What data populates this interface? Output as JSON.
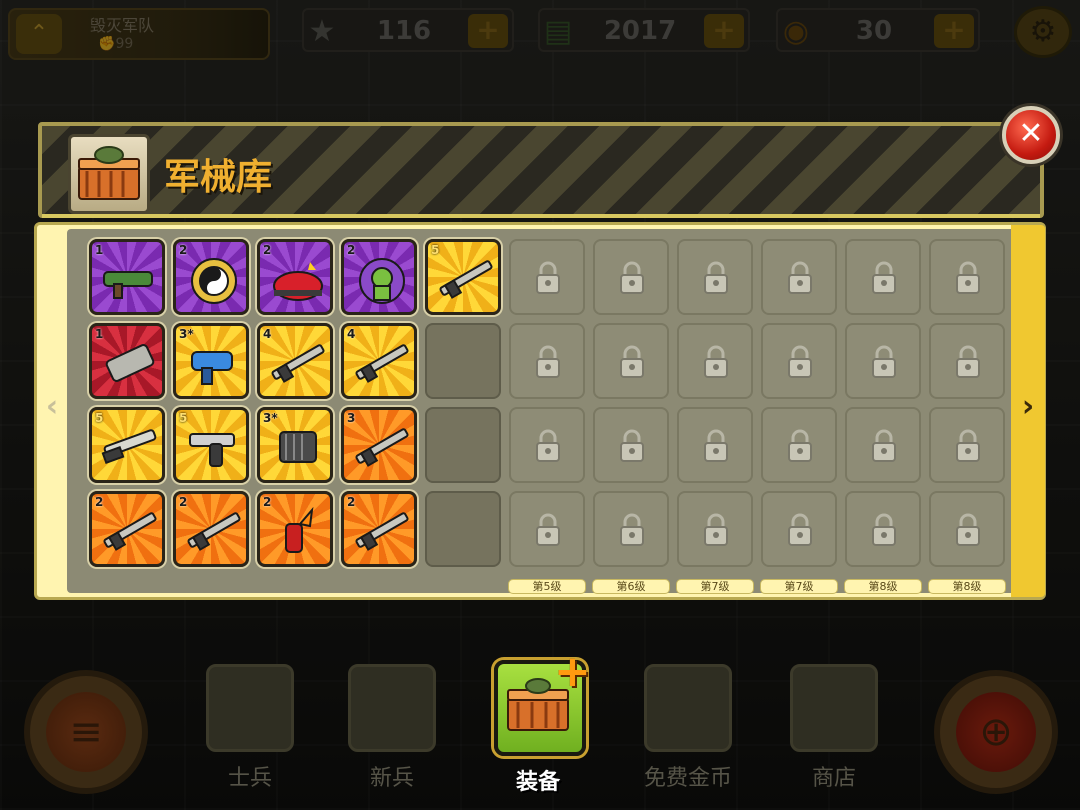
{
  "hud": {
    "team_name": "毁灭军队",
    "power": "99",
    "stars": "116",
    "cash": "2017",
    "coins": "30",
    "plus": "+"
  },
  "panel": {
    "title": "军械库",
    "close": "✕"
  },
  "nav": {
    "prev_arrow": "‹",
    "next_arrow": "›"
  },
  "items": [
    {
      "level": "1",
      "rarity": "purple",
      "icon": "rocket-launcher-icon"
    },
    {
      "level": "2",
      "rarity": "purple",
      "icon": "yin-yang-medal-icon"
    },
    {
      "level": "2",
      "rarity": "purple",
      "icon": "alarm-helmet-icon"
    },
    {
      "level": "2",
      "rarity": "purple",
      "icon": "soldier-shield-icon"
    },
    {
      "level": "5",
      "rarity": "yellow",
      "icon": "assault-rifle-icon"
    },
    {
      "level": "1",
      "rarity": "red",
      "icon": "cannon-barrel-icon"
    },
    {
      "level": "3*",
      "rarity": "yellow",
      "icon": "taser-gun-icon"
    },
    {
      "level": "4",
      "rarity": "yellow",
      "icon": "heavy-rifle-icon"
    },
    {
      "level": "4",
      "rarity": "yellow",
      "icon": "sniper-rifle-icon"
    },
    {
      "level": "5",
      "rarity": "yellow",
      "icon": "shotgun-icon"
    },
    {
      "level": "5",
      "rarity": "yellow",
      "icon": "pistol-icon"
    },
    {
      "level": "3*",
      "rarity": "yellow",
      "icon": "minigun-icon"
    },
    {
      "level": "3",
      "rarity": "orange",
      "icon": "battle-rifle-icon"
    },
    {
      "level": "2",
      "rarity": "orange",
      "icon": "plasma-rifle-icon"
    },
    {
      "level": "2",
      "rarity": "orange",
      "icon": "smg-icon"
    },
    {
      "level": "2",
      "rarity": "orange",
      "icon": "molotov-icon"
    },
    {
      "level": "2",
      "rarity": "orange",
      "icon": "marksman-rifle-icon"
    }
  ],
  "unlock_labels": [
    "第5级",
    "第6级",
    "第7级",
    "第7级",
    "第8级",
    "第8级"
  ],
  "bottom_nav": {
    "soldiers": "士兵",
    "recruits": "新兵",
    "equipment": "装备",
    "free_coins": "免费金币",
    "shop": "商店"
  },
  "colors": {
    "title": "#f0b030",
    "close_red": "#c41a10",
    "active_tab": "#70b020",
    "frame": "#fff4b0"
  }
}
